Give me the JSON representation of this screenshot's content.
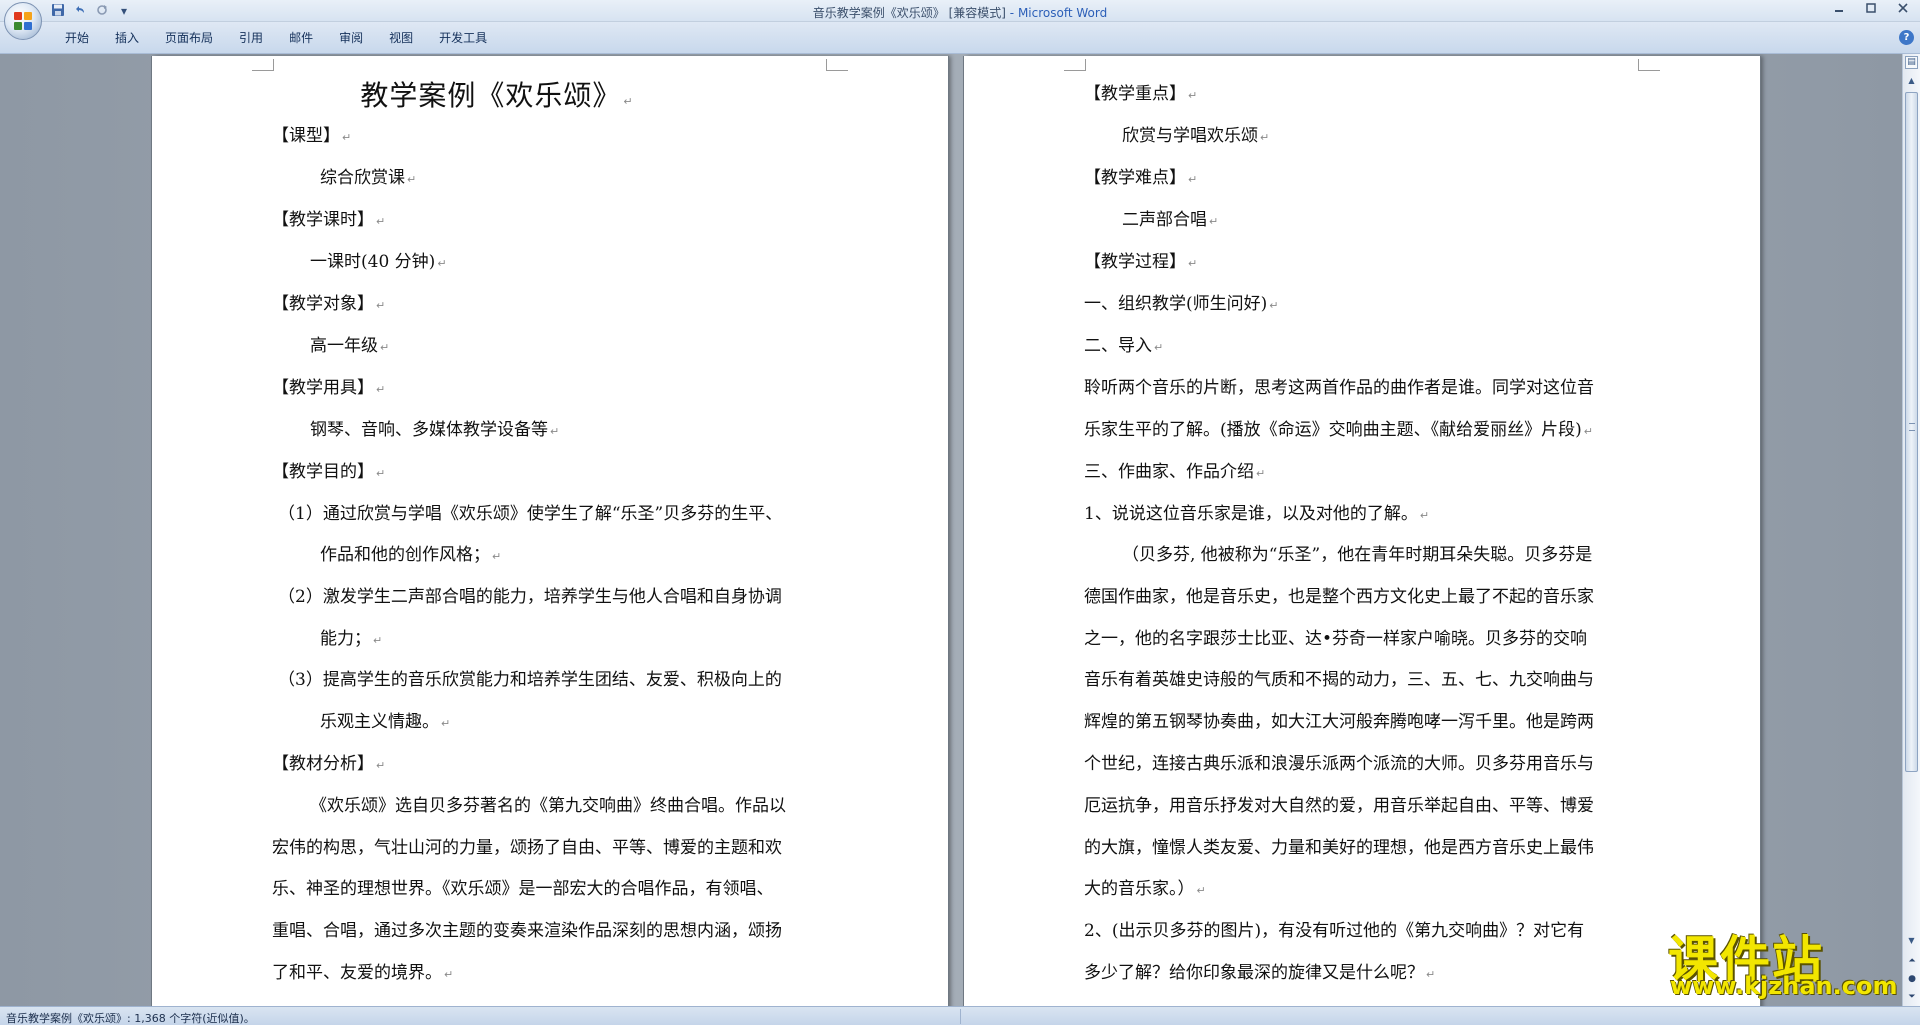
{
  "window": {
    "title_doc": "音乐教学案例《欢乐颂》",
    "title_mode": "[兼容模式]",
    "title_sep": " - ",
    "title_app": "Microsoft Word"
  },
  "ribbon": {
    "tabs": [
      "开始",
      "插入",
      "页面布局",
      "引用",
      "邮件",
      "审阅",
      "视图",
      "开发工具"
    ]
  },
  "quick_access": {
    "customize_glyph": "▾"
  },
  "colors": {
    "accent": "#2c5fb8",
    "watermark": "#f2e600",
    "office_logo": [
      "#e03a1e",
      "#f5a31b",
      "#3b8a2f",
      "#2f6fd1"
    ]
  },
  "icons": [
    "office-logo-icon",
    "save-icon",
    "undo-icon",
    "redo-icon",
    "minimize-icon",
    "maximize-icon",
    "close-icon",
    "help-icon"
  ],
  "document": {
    "title": "教学案例《欢乐颂》",
    "left_lines": [
      "【课型】",
      "综合欣赏课",
      "【教学课时】",
      "一课时(40 分钟)",
      "【教学对象】",
      "高一年级",
      "【教学用具】",
      "钢琴、音响、多媒体教学设备等",
      "【教学目的】",
      "（1）通过欣赏与学唱《欢乐颂》使学生了解“乐圣”贝多芬的生平、",
      "作品和他的创作风格；",
      "（2）激发学生二声部合唱的能力，培养学生与他人合唱和自身协调",
      "能力；",
      "（3）提高学生的音乐欣赏能力和培养学生团结、友爱、积极向上的",
      "乐观主义情趣。",
      "【教材分析】",
      "《欢乐颂》选自贝多芬著名的《第九交响曲》终曲合唱。作品以",
      "宏伟的构思，气壮山河的力量，颂扬了自由、平等、博爱的主题和欢",
      "乐、神圣的理想世界。《欢乐颂》是一部宏大的合唱作品，有领唱、",
      "重唱、合唱，通过多次主题的变奏来渲染作品深刻的思想内涵，颂扬",
      "了和平、友爱的境界。"
    ],
    "right_lines": [
      "【教学重点】",
      "欣赏与学唱欢乐颂",
      "【教学难点】",
      "二声部合唱",
      "【教学过程】",
      "一、组织教学(师生问好)",
      "二、导入",
      "聆听两个音乐的片断，思考这两首作品的曲作者是谁。同学对这位音",
      "乐家生平的了解。(播放《命运》交响曲主题、《献给爱丽丝》片段)",
      "三、作曲家、作品介绍",
      "1、说说这位音乐家是谁，以及对他的了解。",
      "（贝多芬, 他被称为“乐圣”，他在青年时期耳朵失聪。贝多芬是",
      "德国作曲家，他是音乐史，也是整个西方文化史上最了不起的音乐家",
      "之一，他的名字跟莎士比亚、达•芬奇一样家户喻晓。贝多芬的交响",
      "音乐有着英雄史诗般的气质和不揭的动力，三、五、七、九交响曲与",
      "辉煌的第五钢琴协奏曲，如大江大河般奔腾咆哮一泻千里。他是跨两",
      "个世纪，连接古典乐派和浪漫乐派两个派流的大师。贝多芬用音乐与",
      "厄运抗争，用音乐抒发对大自然的爱，用音乐举起自由、平等、博爱",
      "的大旗，憧憬人类友爱、力量和美好的理想，他是西方音乐史上最伟",
      "大的音乐家。）",
      "2、(出示贝多芬的图片)，有没有听过他的《第九交响曲》？对它有",
      "多少了解？给你印象最深的旋律又是什么呢？"
    ]
  },
  "status": {
    "text": "音乐教学案例《欢乐颂》: 1,368 个字符(近似值)。"
  },
  "watermark": {
    "cn": "课件站",
    "url": "www.kjzhan.com"
  }
}
